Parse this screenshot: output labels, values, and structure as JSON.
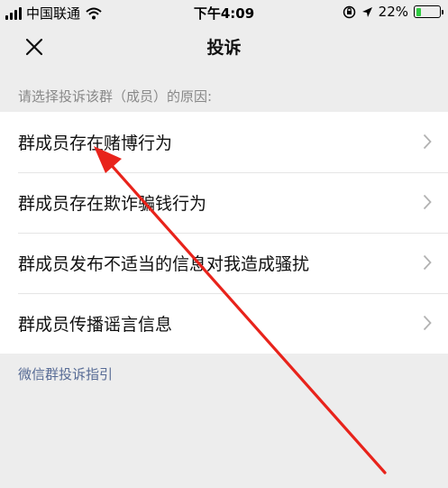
{
  "status_bar": {
    "carrier": "中国联通",
    "time": "下午4:09",
    "battery_percent": "22%",
    "battery_level": 0.22
  },
  "nav": {
    "title": "投诉"
  },
  "prompt": "请选择投诉该群（成员）的原因:",
  "reasons": [
    "群成员存在赌博行为",
    "群成员存在欺诈骗钱行为",
    "群成员发布不适当的信息对我造成骚扰",
    "群成员传播谣言信息"
  ],
  "guide_link": "微信群投诉指引",
  "colors": {
    "background": "#ededed",
    "link": "#576b95",
    "annotation_arrow": "#e8231b",
    "battery": "#2ecc40"
  },
  "icons": [
    "signal-bars-icon",
    "wifi-icon",
    "orientation-lock-icon",
    "location-icon",
    "battery-icon",
    "close-icon",
    "chevron-right-icon"
  ]
}
